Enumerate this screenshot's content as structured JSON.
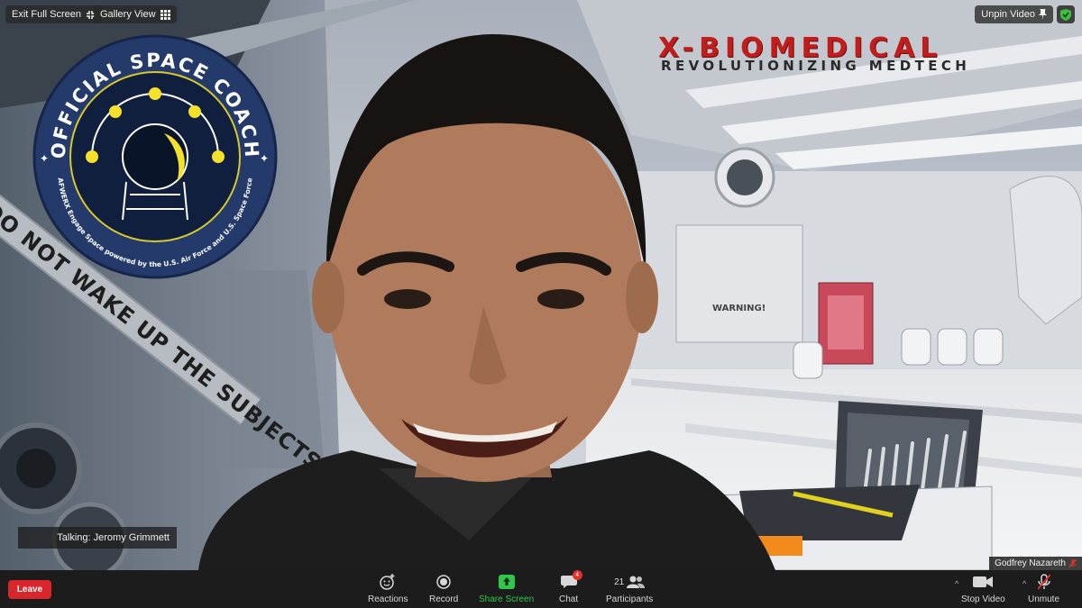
{
  "top_bar": {
    "exit_fullscreen_label": "Exit Full Screen",
    "gallery_view_label": "Gallery View",
    "unpin_video_label": "Unpin Video"
  },
  "background": {
    "brand_title": "X-BIOMEDICAL",
    "brand_subtitle": "REVOLUTIONIZING MEDTECH",
    "tape_text": "DO NOT WAKE UP THE SUBJECTS M",
    "warning_sign": "WARNING!"
  },
  "badge": {
    "top_text": "OFFICIAL SPACE COACH",
    "bottom_text": "AFWERX Engage Space powered by the U.S. Air Force and U.S. Space Force"
  },
  "talking_indicator": "Talking: Jeromy Grimmett",
  "participant_name": "Godfrey Nazareth",
  "toolbar": {
    "unmute_label": "Unmute",
    "stop_video_label": "Stop Video",
    "participants_label": "Participants",
    "participants_count": "21",
    "chat_label": "Chat",
    "chat_count": "4",
    "share_screen_label": "Share Screen",
    "record_label": "Record",
    "reactions_label": "Reactions",
    "leave_label": "Leave"
  },
  "colors": {
    "leave": "#d9262b",
    "share_screen": "#2ec74b",
    "brand_red": "#c21d1d",
    "security_green": "#3fbf3f"
  }
}
